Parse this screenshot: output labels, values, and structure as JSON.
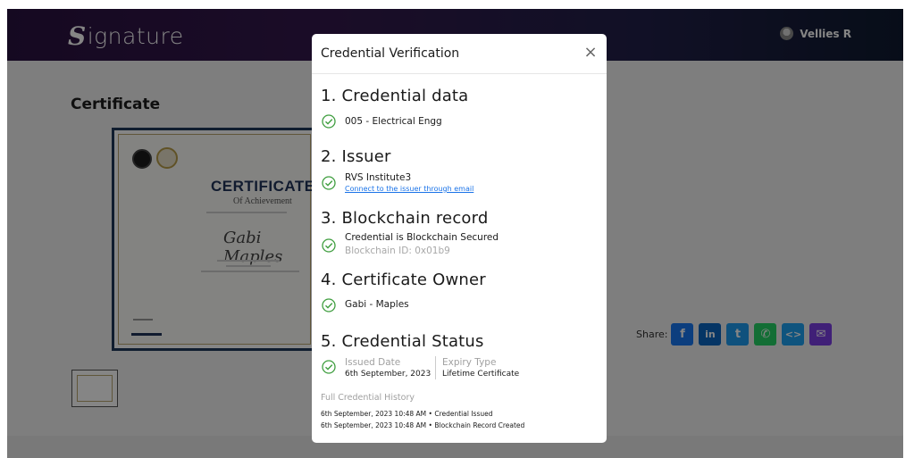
{
  "app": {
    "logo_text": "ignature",
    "logo_mark": "S"
  },
  "user": {
    "name": "Vellies R"
  },
  "page": {
    "title": "Certificate"
  },
  "certificate_preview": {
    "heading": "CERTIFICATE",
    "subheading": "Of Achievement",
    "recipient": "Gabi Maples"
  },
  "share": {
    "label": "Share:",
    "buttons": [
      {
        "icon": "facebook-icon",
        "glyph": "f",
        "color": "#1877f2"
      },
      {
        "icon": "linkedin-icon",
        "glyph": "in",
        "color": "#0a66c2"
      },
      {
        "icon": "twitter-icon",
        "glyph": "t",
        "color": "#1d9bf0"
      },
      {
        "icon": "whatsapp-icon",
        "glyph": "✆",
        "color": "#25d366"
      },
      {
        "icon": "embed-icon",
        "glyph": "<>",
        "color": "#1da1f2"
      },
      {
        "icon": "email-icon",
        "glyph": "✉",
        "color": "#7b3fe4"
      }
    ]
  },
  "modal": {
    "title": "Credential Verification",
    "close_glyph": "×",
    "sections": {
      "credential_data": {
        "title": "1. Credential data",
        "value": "005 - Electrical Engg"
      },
      "issuer": {
        "title": "2. Issuer",
        "name": "RVS Institute3",
        "link": "Connect to the issuer through email"
      },
      "blockchain": {
        "title": "3. Blockchain record",
        "status": "Credential is Blockchain Secured",
        "id": "Blockchain ID: 0x01b9"
      },
      "owner": {
        "title": "4. Certificate Owner",
        "name": "Gabi - Maples"
      },
      "status": {
        "title": "5. Credential Status",
        "issued_label": "Issued Date",
        "issued_value": "6th September, 2023",
        "expiry_label": "Expiry Type",
        "expiry_value": "Lifetime Certificate"
      }
    },
    "history": {
      "title": "Full Credential History",
      "items": [
        "6th September, 2023 10:48 AM • Credential Issued",
        "6th September, 2023 10:48 AM • Blockchain Record Created"
      ]
    }
  },
  "colors": {
    "check": "#3f9e3f",
    "link": "#1a73e8"
  }
}
